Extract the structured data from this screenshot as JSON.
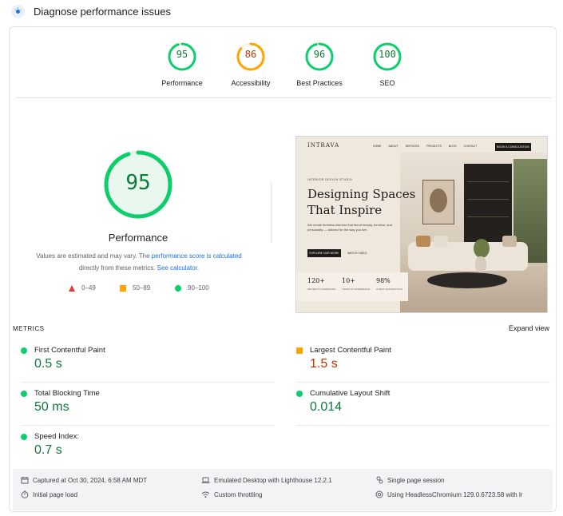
{
  "section": {
    "title": "Diagnose performance issues"
  },
  "scores": [
    {
      "label": "Performance",
      "value": "95",
      "color": "#0cce6b",
      "text_color": "#0c7b38",
      "fraction": 0.95
    },
    {
      "label": "Accessibility",
      "value": "86",
      "color": "#ffa400",
      "text_color": "#c33300",
      "fraction": 0.86
    },
    {
      "label": "Best Practices",
      "value": "96",
      "color": "#0cce6b",
      "text_color": "#0c7b38",
      "fraction": 0.96
    },
    {
      "label": "SEO",
      "value": "100",
      "color": "#0cce6b",
      "text_color": "#0c7b38",
      "fraction": 1.0
    }
  ],
  "main_score": {
    "value": "95",
    "label": "Performance",
    "fraction": 0.95
  },
  "note": {
    "text1": "Values are estimated and may vary. The ",
    "link1": "performance score is calculated",
    "text2": "directly from these metrics. ",
    "link2": "See calculator."
  },
  "legend": [
    {
      "range": "0–49",
      "shape": "triangle",
      "color": "#e53935"
    },
    {
      "range": "50–89",
      "shape": "square",
      "color": "#ffa400"
    },
    {
      "range": "90–100",
      "shape": "circle",
      "color": "#0cce6b"
    }
  ],
  "screenshot": {
    "brand": "INTRAVA",
    "nav_links": [
      "HOME",
      "ABOUT",
      "SERVICES",
      "PROJECTS",
      "BLOG",
      "CONTACT"
    ],
    "cta": "BOOK A CONSULTATION",
    "kicker": "INTERIOR DESIGN STUDIO",
    "headline_line1": "Designing Spaces",
    "headline_line2": "That Inspire",
    "paragraph": "We create timeless interiors that blend beauty, function, and personality — tailored for the way you live.",
    "button_primary": "EXPLORE OUR WORK",
    "button_secondary": "WATCH VIDEO",
    "stats": [
      {
        "value": "120+",
        "label": "PROJECTS COMPLETED"
      },
      {
        "value": "10+",
        "label": "YEARS OF EXPERIENCE"
      },
      {
        "value": "98%",
        "label": "CLIENT SATISFACTION"
      }
    ]
  },
  "metrics": {
    "header": "METRICS",
    "expand_label": "Expand view",
    "items": [
      {
        "name": "First Contentful Paint",
        "value": "0.5 s",
        "status": "good"
      },
      {
        "name": "Largest Contentful Paint",
        "value": "1.5 s",
        "status": "average"
      },
      {
        "name": "Total Blocking Time",
        "value": "50 ms",
        "status": "good"
      },
      {
        "name": "Cumulative Layout Shift",
        "value": "0.014",
        "status": "good"
      },
      {
        "name": "Speed Index:",
        "value": "0.7 s",
        "status": "good"
      }
    ]
  },
  "footer": {
    "captured": "Captured at Oct 30, 2024, 6:58 AM MDT",
    "emulated": "Emulated Desktop with Lighthouse 12.2.1",
    "session": "Single page session",
    "load": "Initial page load",
    "throttling": "Custom throttling",
    "browser": "Using HeadlessChromium 129.0.6723.58 with lr"
  }
}
